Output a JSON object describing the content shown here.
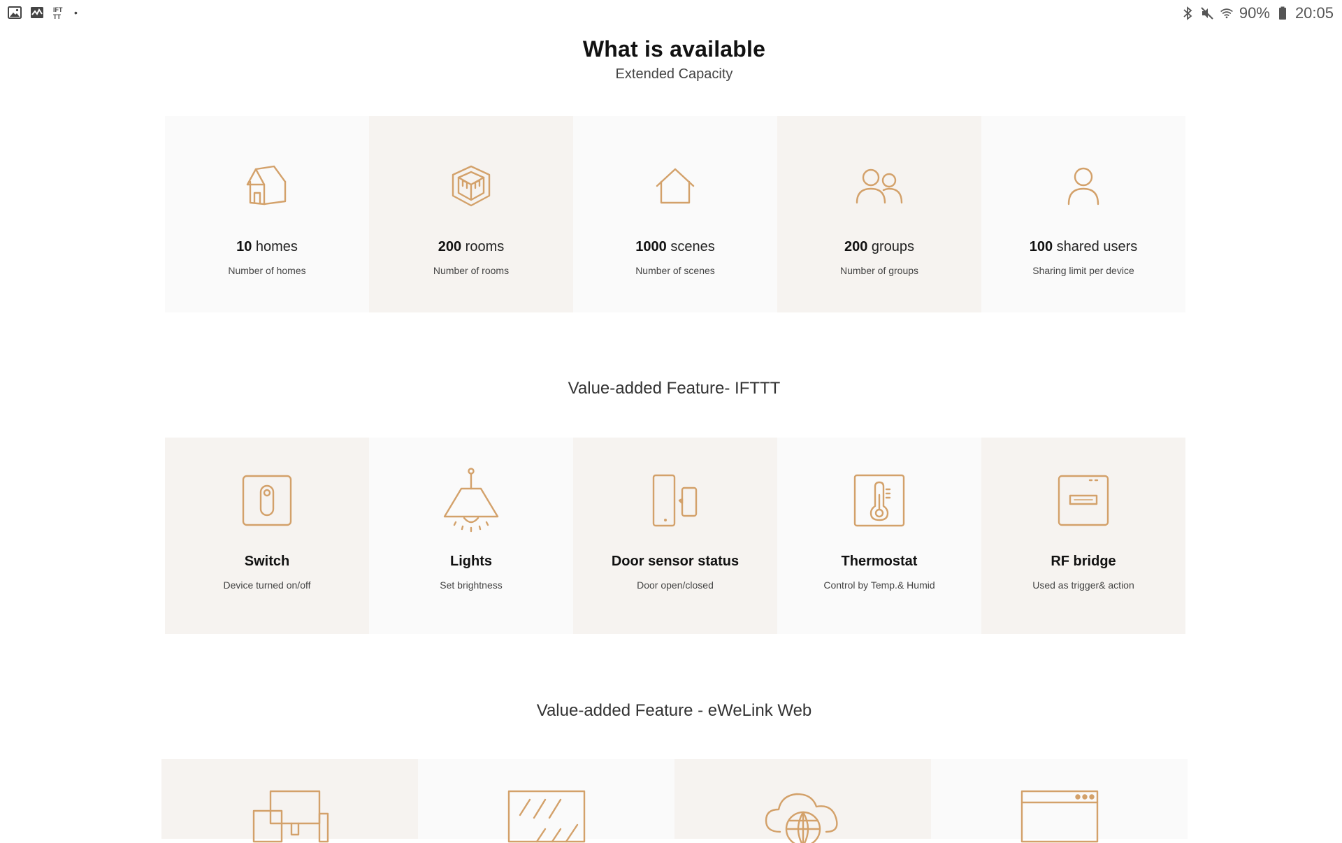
{
  "status_bar": {
    "left_icons": [
      "image-icon",
      "activity-icon",
      "ifttt-icon",
      "dot-icon"
    ],
    "ifttt_label": "IFT\nTT",
    "battery_percent": "90%",
    "time": "20:05",
    "right_icons": [
      "bluetooth-icon",
      "mute-icon",
      "wifi-icon",
      "battery-icon"
    ]
  },
  "header": {
    "title": "What is available",
    "subtitle": "Extended Capacity"
  },
  "capacity": {
    "items": [
      {
        "number": "10",
        "unit": " homes",
        "desc": "Number of homes",
        "icon": "home-3d-icon"
      },
      {
        "number": "200",
        "unit": " rooms",
        "desc": "Number of rooms",
        "icon": "room-cube-icon"
      },
      {
        "number": "1000",
        "unit": " scenes",
        "desc": "Number of scenes",
        "icon": "house-outline-icon"
      },
      {
        "number": "200",
        "unit": " groups",
        "desc": "Number of groups",
        "icon": "group-users-icon"
      },
      {
        "number": "100",
        "unit": " shared users",
        "desc": "Sharing limit per device",
        "icon": "user-icon"
      }
    ]
  },
  "ifttt": {
    "title": "Value-added Feature- IFTTT",
    "items": [
      {
        "title": "Switch",
        "desc": "Device turned on/off",
        "icon": "switch-icon"
      },
      {
        "title": "Lights",
        "desc": "Set brightness",
        "icon": "lamp-icon"
      },
      {
        "title": "Door sensor status",
        "desc": "Door open/closed",
        "icon": "door-sensor-icon"
      },
      {
        "title": "Thermostat",
        "desc": "Control by Temp.& Humid",
        "icon": "thermometer-icon"
      },
      {
        "title": "RF bridge",
        "desc": "Used as trigger& action",
        "icon": "rf-bridge-icon"
      }
    ]
  },
  "web": {
    "title": "Value-added Feature - eWeLink Web",
    "icons": [
      "devices-icon",
      "glass-panel-icon",
      "cloud-globe-icon",
      "browser-window-icon"
    ]
  },
  "colors": {
    "accent": "#d3a16a",
    "card_light": "#fafafa",
    "card_dark": "#f6f3f0"
  }
}
